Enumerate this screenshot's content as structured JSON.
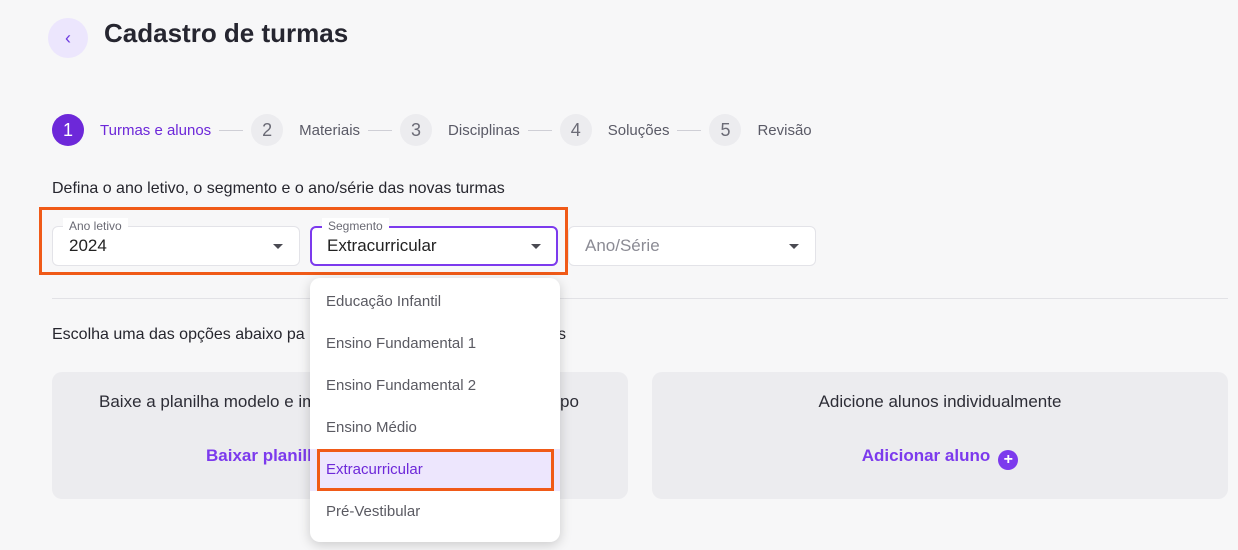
{
  "header": {
    "back_icon": "‹",
    "title": "Cadastro de turmas"
  },
  "stepper": [
    {
      "num": "1",
      "label": "Turmas e alunos"
    },
    {
      "num": "2",
      "label": "Materiais"
    },
    {
      "num": "3",
      "label": "Disciplinas"
    },
    {
      "num": "4",
      "label": "Soluções"
    },
    {
      "num": "5",
      "label": "Revisão"
    }
  ],
  "form": {
    "instruction": "Defina o ano letivo, o segmento e o ano/série das novas turmas",
    "ano_letivo": {
      "label": "Ano letivo",
      "value": "2024"
    },
    "segmento": {
      "label": "Segmento",
      "value": "Extracurricular"
    },
    "ano_serie": {
      "placeholder": "Ano/Série"
    }
  },
  "dropdown": {
    "options": [
      "Educação Infantil",
      "Ensino Fundamental 1",
      "Ensino Fundamental 2",
      "Ensino Médio",
      "Extracurricular",
      "Pré-Vestibular"
    ],
    "selected": "Extracurricular"
  },
  "options_section": {
    "title": "Escolha uma das opções abaixo pa",
    "title_tail": "s",
    "card_left": {
      "text_start": "Baixe a planilha modelo e im",
      "text_end": "po",
      "link": "Baixar planilh"
    },
    "card_right": {
      "text": "Adicione alunos individualmente",
      "link": "Adicionar aluno",
      "icon": "+"
    }
  },
  "colors": {
    "accent": "#7c3aed",
    "highlight": "#f05a18"
  }
}
